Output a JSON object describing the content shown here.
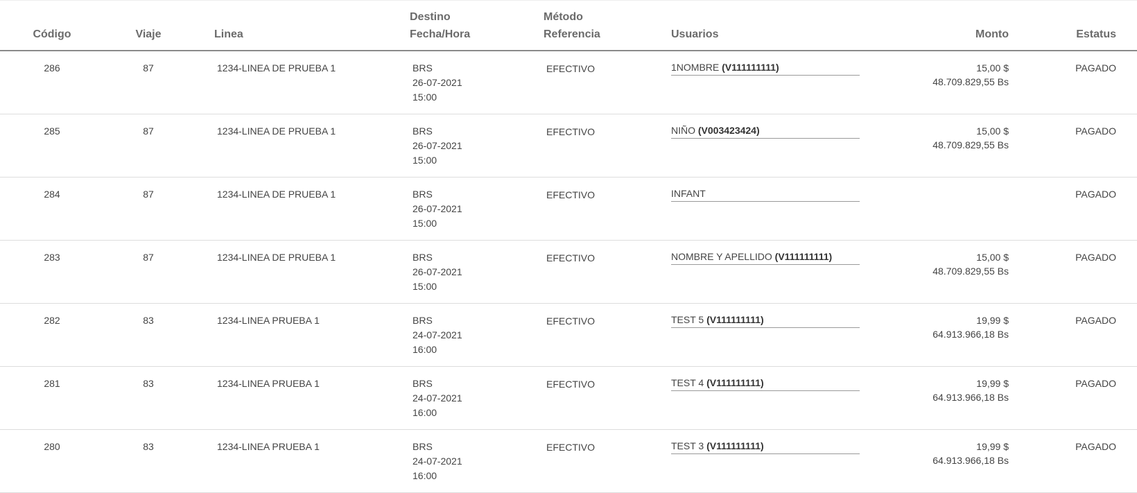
{
  "headers": {
    "codigo": "Código",
    "viaje": "Viaje",
    "linea": "Linea",
    "destino": "Destino",
    "fecha_hora": "Fecha/Hora",
    "metodo": "Método",
    "referencia": "Referencia",
    "usuarios": "Usuarios",
    "monto": "Monto",
    "estatus": "Estatus"
  },
  "rows": [
    {
      "codigo": "286",
      "viaje": "87",
      "linea": "1234-LINEA DE PRUEBA 1",
      "destino": "BRS",
      "fecha": "26-07-2021",
      "hora": "15:00",
      "metodo": "EFECTIVO",
      "usuario": "1NOMBRE",
      "usuario_doc": "(V111111111)",
      "monto_usd": "15,00 $",
      "monto_bs": "48.709.829,55 Bs",
      "estatus": "PAGADO"
    },
    {
      "codigo": "285",
      "viaje": "87",
      "linea": "1234-LINEA DE PRUEBA 1",
      "destino": "BRS",
      "fecha": "26-07-2021",
      "hora": "15:00",
      "metodo": "EFECTIVO",
      "usuario": "NIÑO",
      "usuario_doc": "(V003423424)",
      "monto_usd": "15,00 $",
      "monto_bs": "48.709.829,55 Bs",
      "estatus": "PAGADO"
    },
    {
      "codigo": "284",
      "viaje": "87",
      "linea": "1234-LINEA DE PRUEBA 1",
      "destino": "BRS",
      "fecha": "26-07-2021",
      "hora": "15:00",
      "metodo": "EFECTIVO",
      "usuario": "INFANT",
      "usuario_doc": "",
      "monto_usd": "",
      "monto_bs": "",
      "estatus": "PAGADO"
    },
    {
      "codigo": "283",
      "viaje": "87",
      "linea": "1234-LINEA DE PRUEBA 1",
      "destino": "BRS",
      "fecha": "26-07-2021",
      "hora": "15:00",
      "metodo": "EFECTIVO",
      "usuario": "NOMBRE Y APELLIDO",
      "usuario_doc": "(V111111111)",
      "monto_usd": "15,00 $",
      "monto_bs": "48.709.829,55 Bs",
      "estatus": "PAGADO"
    },
    {
      "codigo": "282",
      "viaje": "83",
      "linea": "1234-LINEA PRUEBA 1",
      "destino": "BRS",
      "fecha": "24-07-2021",
      "hora": "16:00",
      "metodo": "EFECTIVO",
      "usuario": "TEST 5",
      "usuario_doc": "(V111111111)",
      "monto_usd": "19,99 $",
      "monto_bs": "64.913.966,18 Bs",
      "estatus": "PAGADO"
    },
    {
      "codigo": "281",
      "viaje": "83",
      "linea": "1234-LINEA PRUEBA 1",
      "destino": "BRS",
      "fecha": "24-07-2021",
      "hora": "16:00",
      "metodo": "EFECTIVO",
      "usuario": "TEST 4",
      "usuario_doc": "(V111111111)",
      "monto_usd": "19,99 $",
      "monto_bs": "64.913.966,18 Bs",
      "estatus": "PAGADO"
    },
    {
      "codigo": "280",
      "viaje": "83",
      "linea": "1234-LINEA PRUEBA 1",
      "destino": "BRS",
      "fecha": "24-07-2021",
      "hora": "16:00",
      "metodo": "EFECTIVO",
      "usuario": "TEST 3",
      "usuario_doc": "(V111111111)",
      "monto_usd": "19,99 $",
      "monto_bs": "64.913.966,18 Bs",
      "estatus": "PAGADO"
    }
  ]
}
